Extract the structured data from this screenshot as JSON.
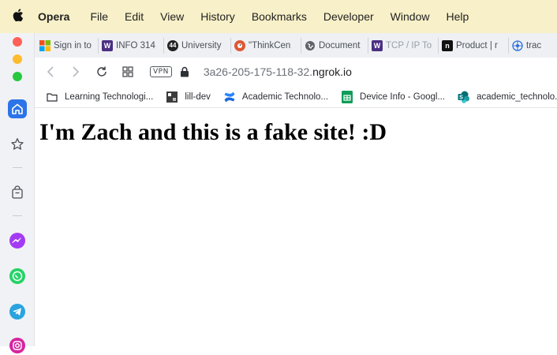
{
  "menubar": {
    "app": "Opera",
    "items": [
      "File",
      "Edit",
      "View",
      "History",
      "Bookmarks",
      "Developer",
      "Window",
      "Help"
    ]
  },
  "tabs": [
    {
      "title": "Sign in to",
      "icon": "microsoft-icon",
      "color": "#f25022"
    },
    {
      "title": "INFO 314",
      "icon": "uw-w-icon",
      "color": "#4b2e83"
    },
    {
      "title": "University",
      "icon": "forty-four-icon",
      "color": "#222222"
    },
    {
      "title": "\"ThinkCen",
      "icon": "duckduckgo-icon",
      "color": "#de5833"
    },
    {
      "title": "Document",
      "icon": "globe-icon",
      "color": "#5f6368"
    },
    {
      "title": "TCP / IP To",
      "icon": "uw-w-icon",
      "color": "#4b2e83"
    },
    {
      "title": "Product | r",
      "icon": "notion-icon",
      "color": "#111111"
    },
    {
      "title": "trac",
      "icon": "network-icon",
      "color": "#2a6fdb"
    }
  ],
  "toolbar": {
    "vpn_label": "VPN",
    "url_prefix": "3a26-205-175-118-32.",
    "url_host": "ngrok.io"
  },
  "bookmarks": [
    {
      "label": "Learning Technologi...",
      "icon": "folder-icon"
    },
    {
      "label": "lill-dev",
      "icon": "pixel-app-icon"
    },
    {
      "label": "Academic Technolo...",
      "icon": "confluence-icon"
    },
    {
      "label": "Device Info - Googl...",
      "icon": "google-sheets-icon"
    },
    {
      "label": "academic_technolo...",
      "icon": "sharepoint-icon"
    }
  ],
  "page": {
    "heading": "I'm Zach and this is a fake site! :D"
  }
}
